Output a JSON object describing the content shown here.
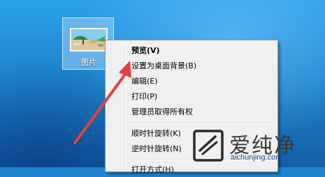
{
  "desktop": {
    "icon_label": "图片"
  },
  "context_menu": {
    "items": [
      {
        "label": "预览(V)",
        "default": true
      },
      {
        "label": "设置为桌面背景(B)"
      },
      {
        "label": "编辑(E)"
      },
      {
        "label": "打印(P)"
      },
      {
        "label": "管理员取得所有权"
      },
      {
        "label": "顺时针旋转(K)"
      },
      {
        "label": "逆时针旋转(N)"
      },
      {
        "label": "打开方式(H)"
      }
    ]
  },
  "watermark": {
    "name": "爱纯净",
    "url": "aichunjing.com"
  },
  "colors": {
    "arrow": "#e64040",
    "desktop_blue": "#1f86cf",
    "menu_bg": "#f0f0f0"
  },
  "icons": [
    "image-file-icon",
    "red-arrow",
    "watermark-logo-icon"
  ]
}
